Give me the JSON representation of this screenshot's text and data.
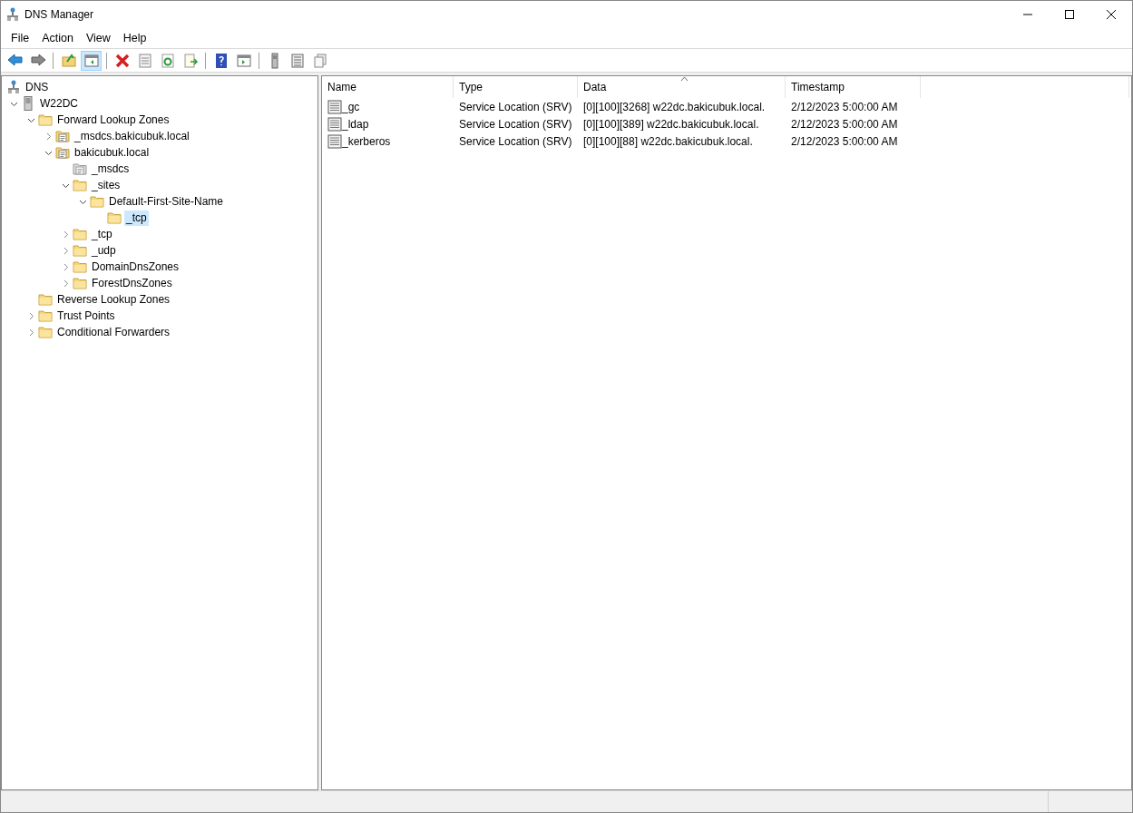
{
  "window": {
    "title": "DNS Manager"
  },
  "menu": [
    "File",
    "Action",
    "View",
    "Help"
  ],
  "toolbar": [
    {
      "kind": "back",
      "pressed": false
    },
    {
      "kind": "forward",
      "pressed": false
    },
    {
      "kind": "sep"
    },
    {
      "kind": "up",
      "pressed": false
    },
    {
      "kind": "tree",
      "pressed": true
    },
    {
      "kind": "sep"
    },
    {
      "kind": "delete",
      "pressed": false
    },
    {
      "kind": "properties",
      "pressed": false
    },
    {
      "kind": "refresh",
      "pressed": false
    },
    {
      "kind": "export",
      "pressed": false
    },
    {
      "kind": "sep"
    },
    {
      "kind": "help",
      "pressed": false
    },
    {
      "kind": "action-pane",
      "pressed": false
    },
    {
      "kind": "sep"
    },
    {
      "kind": "server",
      "pressed": false
    },
    {
      "kind": "list",
      "pressed": false
    },
    {
      "kind": "copy",
      "pressed": false
    }
  ],
  "tree": [
    {
      "label": "DNS",
      "kind": "dns",
      "selected": false,
      "children": [
        {
          "label": "W22DC",
          "kind": "server",
          "expanded": true,
          "selected": false,
          "children": [
            {
              "label": "Forward Lookup Zones",
              "kind": "folder",
              "expanded": true,
              "selected": false,
              "children": [
                {
                  "label": "_msdcs.bakicubuk.local",
                  "kind": "zone",
                  "expanded": false,
                  "selected": false
                },
                {
                  "label": "bakicubuk.local",
                  "kind": "zone",
                  "expanded": true,
                  "selected": false,
                  "children": [
                    {
                      "label": "_msdcs",
                      "kind": "delegation",
                      "selected": false
                    },
                    {
                      "label": "_sites",
                      "kind": "folder",
                      "expanded": true,
                      "selected": false,
                      "children": [
                        {
                          "label": "Default-First-Site-Name",
                          "kind": "folder",
                          "expanded": true,
                          "selected": false,
                          "children": [
                            {
                              "label": "_tcp",
                              "kind": "folder",
                              "selected": true
                            }
                          ]
                        }
                      ]
                    },
                    {
                      "label": "_tcp",
                      "kind": "folder",
                      "expanded": false,
                      "selected": false
                    },
                    {
                      "label": "_udp",
                      "kind": "folder",
                      "expanded": false,
                      "selected": false
                    },
                    {
                      "label": "DomainDnsZones",
                      "kind": "folder",
                      "expanded": false,
                      "selected": false
                    },
                    {
                      "label": "ForestDnsZones",
                      "kind": "folder",
                      "expanded": false,
                      "selected": false
                    }
                  ]
                }
              ]
            },
            {
              "label": "Reverse Lookup Zones",
              "kind": "folder",
              "selected": false
            },
            {
              "label": "Trust Points",
              "kind": "folder",
              "expanded": false,
              "selected": false
            },
            {
              "label": "Conditional Forwarders",
              "kind": "folder",
              "expanded": false,
              "selected": false
            }
          ]
        }
      ]
    }
  ],
  "table": {
    "columns": [
      "Name",
      "Type",
      "Data",
      "Timestamp"
    ],
    "rows": [
      {
        "name": "_gc",
        "type": "Service Location (SRV)",
        "data": "[0][100][3268] w22dc.bakicubuk.local.",
        "timestamp": "2/12/2023 5:00:00 AM"
      },
      {
        "name": "_ldap",
        "type": "Service Location (SRV)",
        "data": "[0][100][389] w22dc.bakicubuk.local.",
        "timestamp": "2/12/2023 5:00:00 AM"
      },
      {
        "name": "_kerberos",
        "type": "Service Location (SRV)",
        "data": "[0][100][88] w22dc.bakicubuk.local.",
        "timestamp": "2/12/2023 5:00:00 AM"
      }
    ]
  }
}
